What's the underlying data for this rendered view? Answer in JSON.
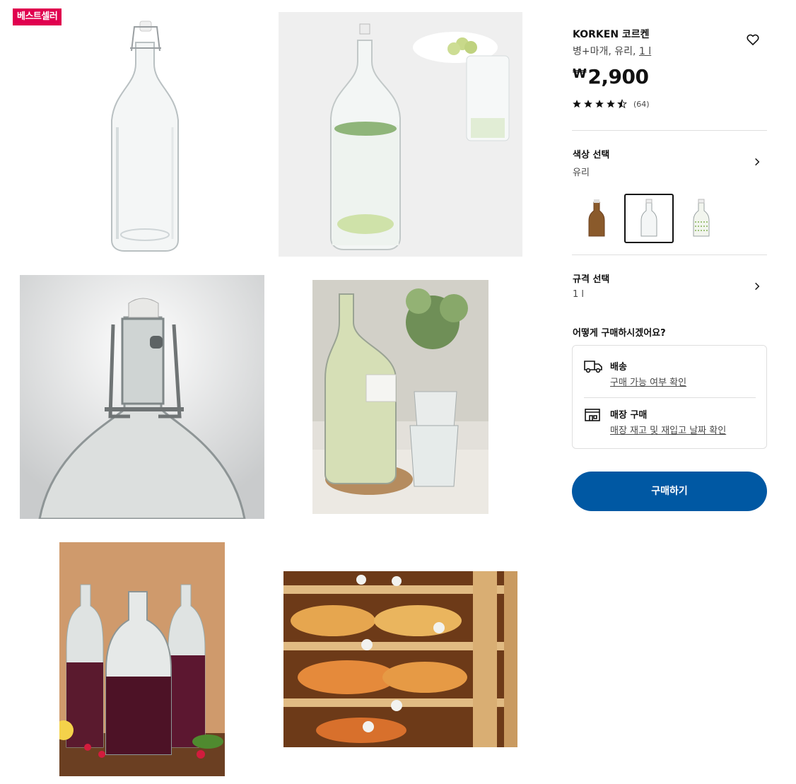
{
  "badge": "베스트셀러",
  "product": {
    "name": "KORKEN 코르켄",
    "subtitle_prefix": "병+마개, 유리, ",
    "subtitle_size": "1 l",
    "price_currency": "₩",
    "price_value": "2,900",
    "rating_value": 4.5,
    "rating_count": "(64)"
  },
  "icons": {
    "favorite": "heart-icon",
    "chevron": "chevron-right-icon",
    "delivery": "truck-icon",
    "store": "store-icon",
    "star": "star-icon"
  },
  "color_select": {
    "label": "색상 선택",
    "value": "유리",
    "swatches": [
      "brown-glass-bottle",
      "clear-glass-bottle",
      "patterned-glass-bottle"
    ],
    "selected_index": 1
  },
  "size_select": {
    "label": "규격 선택",
    "value": "1 l"
  },
  "purchase": {
    "question": "어떻게 구매하시겠어요?",
    "delivery_title": "배송",
    "delivery_link": "구매 가능 여부 확인",
    "store_title": "매장 구매",
    "store_link": "매장 재고 및 재입고 날짜 확인",
    "buy_button": "구매하기"
  },
  "colors": {
    "accent": "#0058a3",
    "badge": "#e0004f",
    "text": "#111111",
    "muted": "#484848",
    "divider": "#dfdfdf"
  }
}
